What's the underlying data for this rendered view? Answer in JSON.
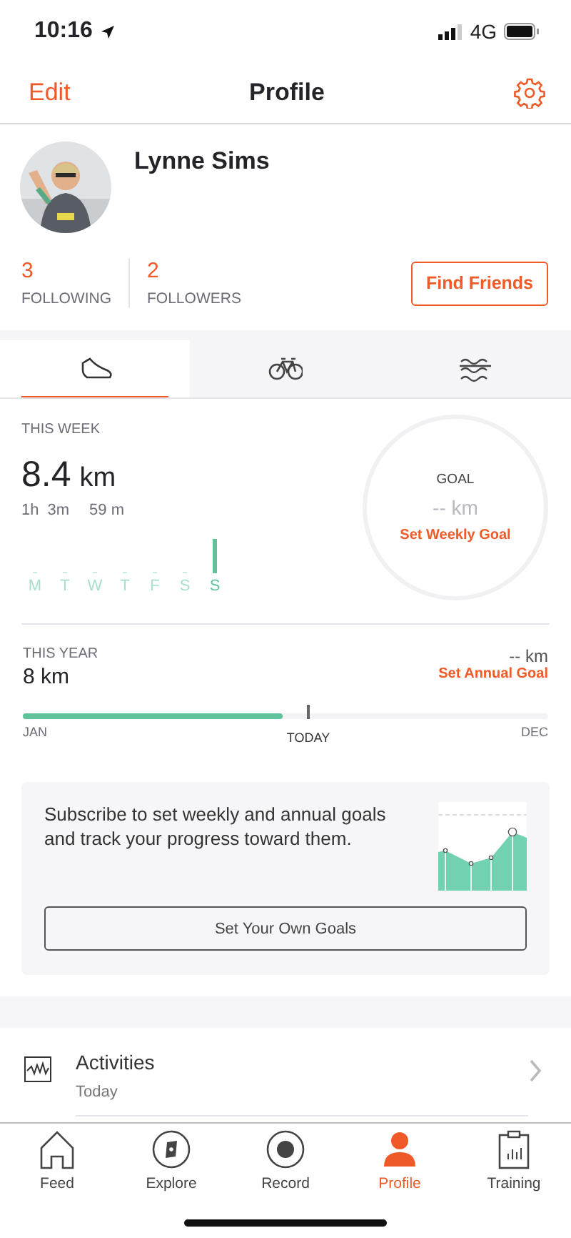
{
  "status_bar": {
    "time": "10:16",
    "network": "4G"
  },
  "header": {
    "left": "Edit",
    "title": "Profile"
  },
  "profile": {
    "name": "Lynne Sims",
    "stats": [
      {
        "value": "3",
        "label": "FOLLOWING"
      },
      {
        "value": "2",
        "label": "FOLLOWERS"
      }
    ],
    "button": "Find Friends"
  },
  "sport_tabs": [
    {
      "kind": "run",
      "selected": true
    },
    {
      "kind": "ride",
      "selected": false
    },
    {
      "kind": "swim",
      "selected": false
    }
  ],
  "this_week": {
    "label": "THIS WEEK",
    "distance": "8.4",
    "unit": "km",
    "time_parts": [
      "1h",
      "3m",
      "59 m"
    ],
    "days": [
      {
        "label": "M",
        "selected": false
      },
      {
        "label": "T",
        "selected": false
      },
      {
        "label": "W",
        "selected": false
      },
      {
        "label": "T",
        "selected": false
      },
      {
        "label": "F",
        "selected": false
      },
      {
        "label": "S",
        "selected": false
      },
      {
        "label": "S",
        "selected": true
      }
    ],
    "goal": {
      "label": "GOAL",
      "value": "-- km",
      "link": "Set Weekly Goal"
    }
  },
  "this_year": {
    "label": "THIS YEAR",
    "distance": "8 km",
    "goal_value": "-- km",
    "goal_link": "Set Annual Goal",
    "level": 0.495,
    "start": "JAN",
    "today": "TODAY",
    "end": "DEC"
  },
  "promo": {
    "text": "Subscribe to set weekly and annual goals and track your progress toward them.",
    "button": "Set Your Own Goals"
  },
  "menu": [
    {
      "title": "Activities",
      "subtitle": "Today"
    }
  ],
  "tab_bar": [
    {
      "kind": "feed",
      "label": "Feed",
      "selected": false
    },
    {
      "kind": "explore",
      "label": "Explore",
      "selected": false
    },
    {
      "kind": "record",
      "label": "Record",
      "selected": false
    },
    {
      "kind": "profile",
      "label": "Profile",
      "selected": true
    },
    {
      "kind": "training",
      "label": "Training",
      "selected": false
    }
  ]
}
